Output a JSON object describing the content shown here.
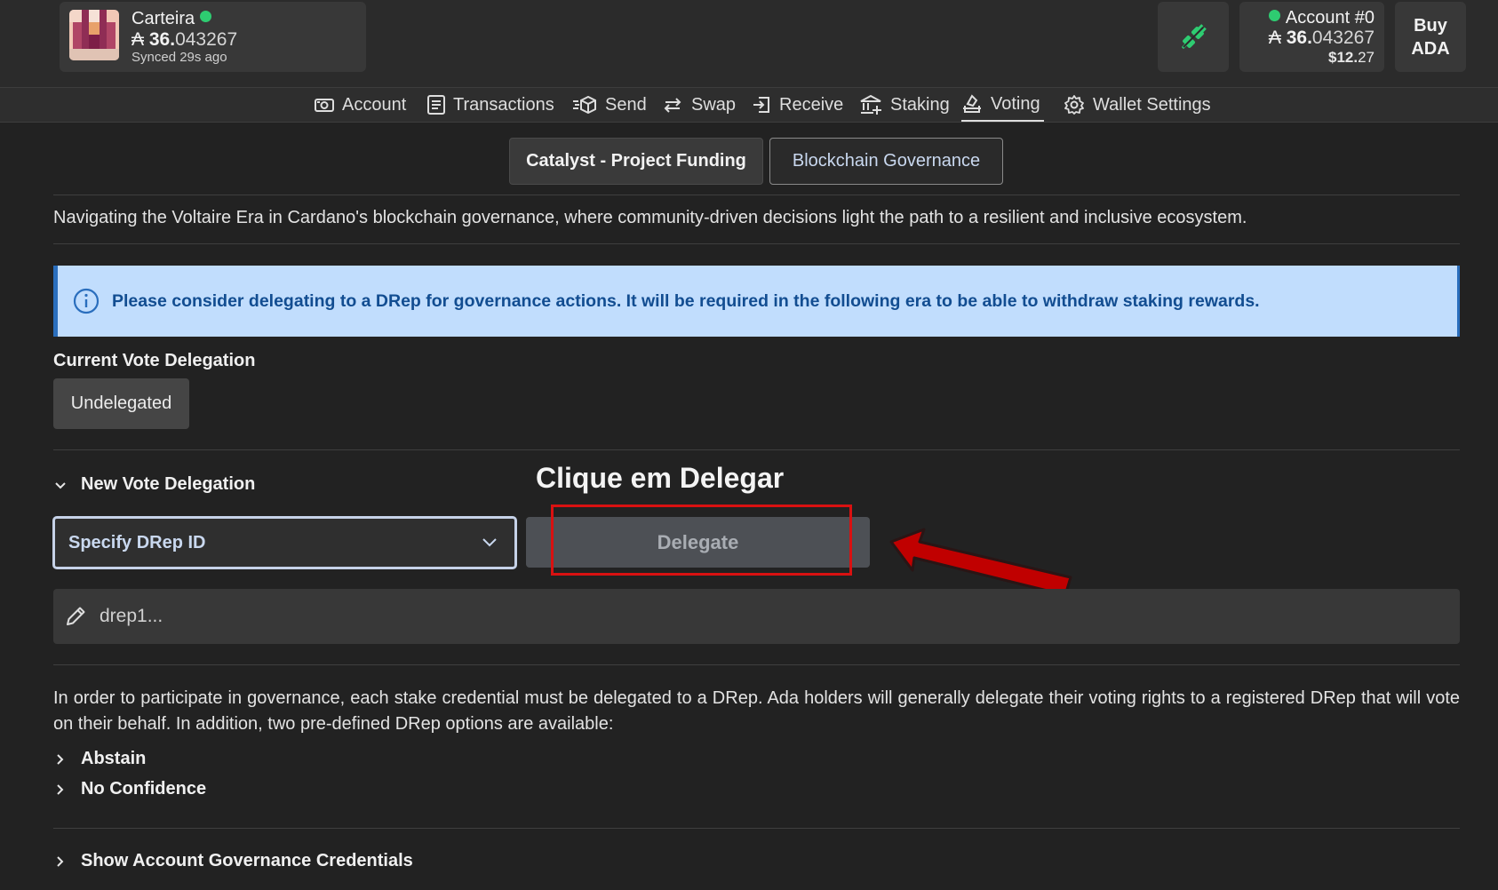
{
  "wallet": {
    "name": "Carteira",
    "currency_symbol": "₳",
    "balance_int": "36.",
    "balance_frac": "043267",
    "sync_status": "Synced 29s ago"
  },
  "account": {
    "name": "Account #0",
    "currency_symbol": "₳",
    "balance_int": "36.",
    "balance_frac": "043267",
    "usd_int": "$12.",
    "usd_frac": "27"
  },
  "buy_button": {
    "line1": "Buy",
    "line2": "ADA"
  },
  "nav": {
    "items": [
      {
        "label": "Account",
        "icon": "camera-icon"
      },
      {
        "label": "Transactions",
        "icon": "list-icon"
      },
      {
        "label": "Send",
        "icon": "send-icon"
      },
      {
        "label": "Swap",
        "icon": "swap-icon"
      },
      {
        "label": "Receive",
        "icon": "receive-icon"
      },
      {
        "label": "Staking",
        "icon": "bank-icon"
      },
      {
        "label": "Voting",
        "icon": "vote-icon"
      },
      {
        "label": "Wallet Settings",
        "icon": "gear-icon"
      }
    ],
    "active": "Voting"
  },
  "tabs": {
    "catalyst": "Catalyst - Project Funding",
    "governance": "Blockchain Governance"
  },
  "intro_text": "Navigating the Voltaire Era in Cardano's blockchain governance, where community-driven decisions light the path to a resilient and inclusive ecosystem.",
  "info_message": "Please consider delegating to a DRep for governance actions. It will be required in the following era to be able to withdraw staking rewards.",
  "current_delegation": {
    "label": "Current Vote Delegation",
    "value": "Undelegated"
  },
  "new_delegation": {
    "label": "New Vote Delegation",
    "select_value": "Specify DRep ID",
    "delegate_label": "Delegate",
    "input_placeholder": "drep1..."
  },
  "annotation": "Clique em Delegar",
  "governance_info": "In order to participate in governance, each stake credential must be delegated to a DRep. Ada holders will generally delegate their voting rights to a registered DRep that will vote on their behalf. In addition, two pre-defined DRep options are available:",
  "options": [
    "Abstain",
    "No Confidence"
  ],
  "credentials_label": "Show Account Governance Credentials",
  "colors": {
    "background": "#222222",
    "info_bg": "#c1ddfd",
    "info_text": "#124d91",
    "status_green": "#2ecc71",
    "highlight_red": "#d91111",
    "arrow_red": "#c00000"
  }
}
